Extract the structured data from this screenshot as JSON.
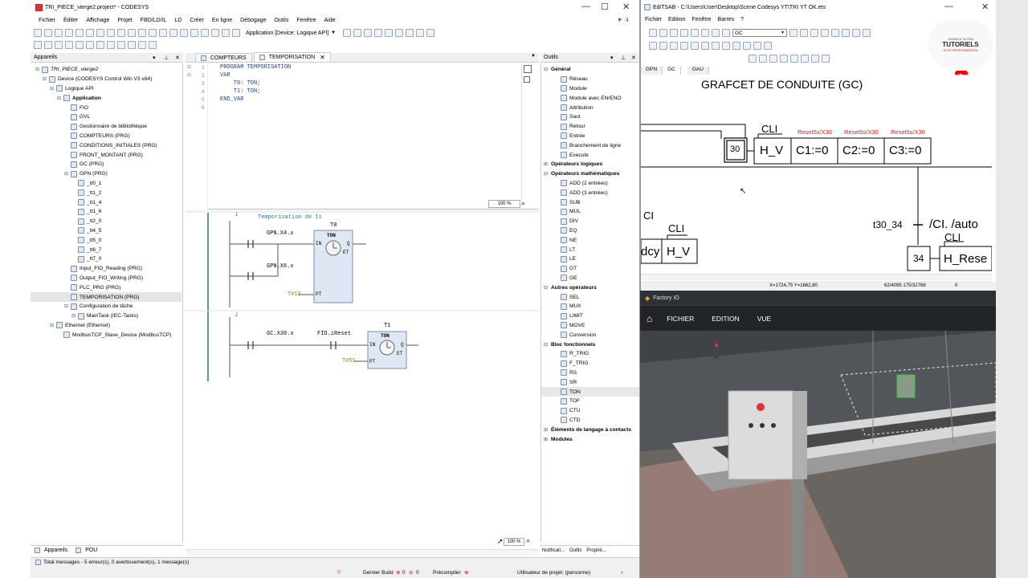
{
  "codesys": {
    "title": "TRI_PIECE_vierge2.project* - CODESYS",
    "menu": [
      "Fichier",
      "Éditer",
      "Affichage",
      "Projet",
      "FBD/LD/IL",
      "LD",
      "Créer",
      "En ligne",
      "Débogage",
      "Outils",
      "Fenêtre",
      "Aide"
    ],
    "alert_count": "4",
    "toolbar_app": "Application [Device: Logique API]",
    "devices_panel_title": "Appareils",
    "tree": [
      {
        "label": "TRI_PIECE_vierge2",
        "indent": 0
      },
      {
        "label": "Device (CODESYS Control Win V3 x64)",
        "indent": 1
      },
      {
        "label": "Logique API",
        "indent": 2
      },
      {
        "label": "Application",
        "indent": 3
      },
      {
        "label": "FIO",
        "indent": 4
      },
      {
        "label": "GVL",
        "indent": 4
      },
      {
        "label": "Gestionnaire de bibliothèque",
        "indent": 4
      },
      {
        "label": "COMPTEURS (PRG)",
        "indent": 4
      },
      {
        "label": "CONDITIONS_INITIALES (PRG)",
        "indent": 4
      },
      {
        "label": "FRONT_MONTANT (PRG)",
        "indent": 4
      },
      {
        "label": "GC (PRG)",
        "indent": 4
      },
      {
        "label": "GPN (PRG)",
        "indent": 4
      },
      {
        "label": "_tt0_1",
        "indent": 5
      },
      {
        "label": "_tt1_2",
        "indent": 5
      },
      {
        "label": "_tt1_4",
        "indent": 5
      },
      {
        "label": "_tt1_6",
        "indent": 5
      },
      {
        "label": "_tt2_0",
        "indent": 5
      },
      {
        "label": "_tt4_5",
        "indent": 5
      },
      {
        "label": "_tt5_0",
        "indent": 5
      },
      {
        "label": "_tt6_7",
        "indent": 5
      },
      {
        "label": "_tt7_0",
        "indent": 5
      },
      {
        "label": "Input_FIO_Reading (PRG)",
        "indent": 4
      },
      {
        "label": "Output_FIO_Writing (PRG)",
        "indent": 4
      },
      {
        "label": "PLC_PRG (PRG)",
        "indent": 4
      },
      {
        "label": "TEMPORISATION (PRG)",
        "indent": 4
      },
      {
        "label": "Configuration de tâche",
        "indent": 4
      },
      {
        "label": "MainTask (IEC-Tasks)",
        "indent": 5
      },
      {
        "label": "Ethernet (Ethernet)",
        "indent": 2
      },
      {
        "label": "ModbusTCP_Slave_Device (ModbusTCP)",
        "indent": 3
      }
    ],
    "bottom_tabs": [
      "Appareils",
      "POU"
    ],
    "editor_tabs": [
      "COMPTEURS",
      "TEMPORISATION"
    ],
    "code_lines": [
      "PROGRAM TEMPORISATION",
      "VAR",
      "    T0: TON;",
      "    T1: TON;",
      "END_VAR",
      ""
    ],
    "line_numbers": [
      "1",
      "2",
      "3",
      "4",
      "5",
      "6"
    ],
    "zoom_top": "100 %",
    "zoom_bottom": "100 %",
    "ladder": {
      "comment": "Temporisation de 1s",
      "rung1_num": "1",
      "rung2_num": "2",
      "t0_name": "T0",
      "t1_name": "T1",
      "ton_label": "TON",
      "contact1": "GPN.X4.x",
      "contact2": "GPN.X6.x",
      "contact3": "GC.X30.x",
      "contact4": "FIO.iReset",
      "pt1": "T#1S",
      "pt2": "T#5S",
      "pin_in": "IN",
      "pin_q": "Q",
      "pin_et": "ET",
      "pin_pt": "PT"
    },
    "tools_title": "Outils",
    "tools": [
      {
        "label": "Général",
        "type": "cat"
      },
      {
        "label": "Réseau",
        "type": "item"
      },
      {
        "label": "Module",
        "type": "item"
      },
      {
        "label": "Module avec EN/ENO",
        "type": "item"
      },
      {
        "label": "Attribution",
        "type": "item"
      },
      {
        "label": "Saut",
        "type": "item"
      },
      {
        "label": "Retour",
        "type": "item"
      },
      {
        "label": "Entrée",
        "type": "item"
      },
      {
        "label": "Branchement de ligne",
        "type": "item"
      },
      {
        "label": "Execute",
        "type": "item"
      },
      {
        "label": "Opérateurs logiques",
        "type": "cat"
      },
      {
        "label": "Opérateurs mathématiques",
        "type": "cat"
      },
      {
        "label": "ADD (2 entrées)",
        "type": "item"
      },
      {
        "label": "ADD (3 entrées)",
        "type": "item"
      },
      {
        "label": "SUB",
        "type": "item"
      },
      {
        "label": "MUL",
        "type": "item"
      },
      {
        "label": "DIV",
        "type": "item"
      },
      {
        "label": "EQ",
        "type": "item"
      },
      {
        "label": "NE",
        "type": "item"
      },
      {
        "label": "LT",
        "type": "item"
      },
      {
        "label": "LE",
        "type": "item"
      },
      {
        "label": "GT",
        "type": "item"
      },
      {
        "label": "GE",
        "type": "item"
      },
      {
        "label": "Autres opérateurs",
        "type": "cat"
      },
      {
        "label": "SEL",
        "type": "item"
      },
      {
        "label": "MUX",
        "type": "item"
      },
      {
        "label": "LIMIT",
        "type": "item"
      },
      {
        "label": "MOVE",
        "type": "item"
      },
      {
        "label": "Conversion",
        "type": "item"
      },
      {
        "label": "Bloc fonctionnels",
        "type": "cat"
      },
      {
        "label": "R_TRIG",
        "type": "item"
      },
      {
        "label": "F_TRIG",
        "type": "item"
      },
      {
        "label": "RS",
        "type": "item"
      },
      {
        "label": "SR",
        "type": "item"
      },
      {
        "label": "TON",
        "type": "item"
      },
      {
        "label": "TOF",
        "type": "item"
      },
      {
        "label": "CTU",
        "type": "item"
      },
      {
        "label": "CTD",
        "type": "item"
      },
      {
        "label": "Éléments de langage à contacts",
        "type": "cat"
      },
      {
        "label": "Modules",
        "type": "cat"
      }
    ],
    "tools_tabs": [
      "Notificati...",
      "Outils",
      "Proprié..."
    ],
    "status": {
      "messages": "Total messages - 5 erreur(s), 0 avertissement(s), 1 message(s)",
      "build": "Dernier Build",
      "err": "0",
      "warn": "0",
      "precompile": "Précompiler",
      "user": "Utilisateur de projet: (personne)"
    }
  },
  "editsab": {
    "title": "EdiTSAB - C:\\Users\\User\\Desktop\\Scene Codesys YT\\TRI YT OK.ets",
    "menu": [
      "Fichier",
      "Edition",
      "Fenêtre",
      "Barres",
      "?"
    ],
    "dropdown": "GC",
    "tabs": [
      "GPN",
      "GC",
      "GAU"
    ],
    "heading": "GRAFCET DE CONDUITE (GC)",
    "step30": "30",
    "step34": "34",
    "actions30": [
      "H_V",
      "C1:=0",
      "C2:=0",
      "C3:=0"
    ],
    "cli": "CLI",
    "reset_labels": [
      "Reset5s/X30",
      "Reset5s/X30",
      "Reset5s/X30"
    ],
    "transition_label": "t30_34",
    "transition_cond": "/CI. /auto",
    "left_ci": "CI",
    "left_dcy": "dcy",
    "left_hv": "H_V",
    "h_reset": "H_Rese",
    "coords": "X=1724,75 Y=1662,80",
    "counts": "62/4095 175/32768",
    "zero": "0",
    "logo_text": "TUTORIELS",
    "logo_sub": "ELECTROFORMATION",
    "logo_name": "YANNICK SUTRA"
  },
  "factory": {
    "title": "Factory IO",
    "menu": [
      "FICHIER",
      "EDITION",
      "VUE"
    ]
  },
  "colors": {
    "accent_red": "#d9261c",
    "panel_blue": "#1f6fb8",
    "step_box": "#000000",
    "youtube": "#ff0000"
  }
}
